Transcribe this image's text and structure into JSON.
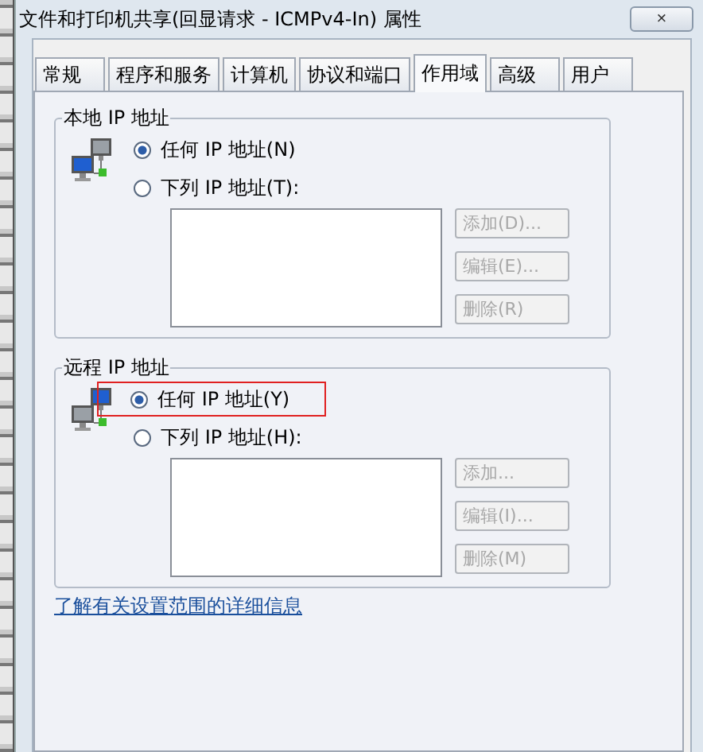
{
  "window": {
    "title": "文件和打印机共享(回显请求 - ICMPv4-In) 属性",
    "close": "×"
  },
  "tabs": [
    {
      "label": "常规",
      "selected": false
    },
    {
      "label": "程序和服务",
      "selected": false
    },
    {
      "label": "计算机",
      "selected": false
    },
    {
      "label": "协议和端口",
      "selected": false
    },
    {
      "label": "作用域",
      "selected": true
    },
    {
      "label": "高级",
      "selected": false
    },
    {
      "label": "用户",
      "selected": false
    }
  ],
  "groups": [
    {
      "title": "本地 IP 地址",
      "options": [
        {
          "label": "任何 IP 地址(N)",
          "selected": true,
          "highlighted": false
        },
        {
          "label": "下列 IP 地址(T):",
          "selected": false,
          "highlighted": false
        }
      ],
      "buttons": [
        {
          "label": "添加(D)...",
          "disabled": true
        },
        {
          "label": "编辑(E)...",
          "disabled": true
        },
        {
          "label": "删除(R)",
          "disabled": true
        }
      ]
    },
    {
      "title": "远程 IP 地址",
      "options": [
        {
          "label": "任何 IP 地址(Y)",
          "selected": true,
          "highlighted": true
        },
        {
          "label": "下列 IP 地址(H):",
          "selected": false,
          "highlighted": false
        }
      ],
      "buttons": [
        {
          "label": "添加...",
          "disabled": true
        },
        {
          "label": "编辑(I)...",
          "disabled": true
        },
        {
          "label": "删除(M)",
          "disabled": true
        }
      ]
    }
  ],
  "link": "了解有关设置范围的详细信息"
}
